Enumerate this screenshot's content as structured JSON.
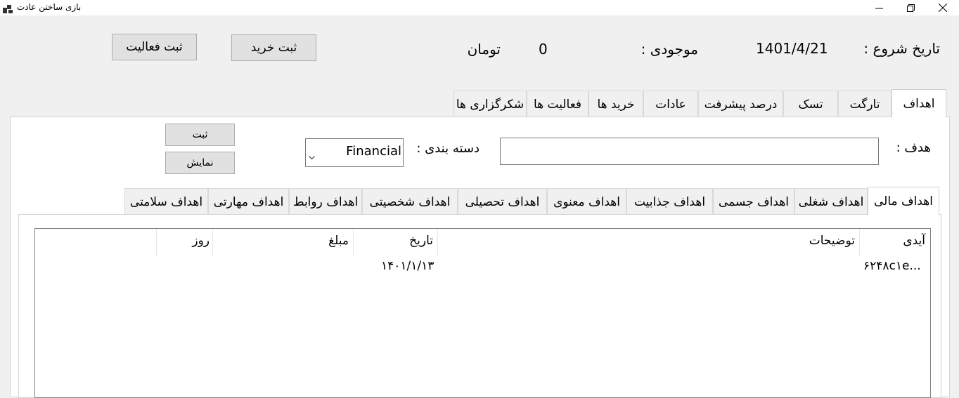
{
  "window": {
    "title": "بازی ساختن عادت",
    "icons": [
      "app-icon",
      "minimize-icon",
      "restore-icon",
      "close-icon"
    ]
  },
  "header": {
    "start_date_label": "تاریخ شروع :",
    "start_date_value": "1401/4/21",
    "balance_label": "موجودی :",
    "balance_value": "0",
    "currency": "تومان",
    "register_purchase_button": "ثبت خرید",
    "register_activity_button": "ثبت فعالیت"
  },
  "main_tabs": [
    {
      "label": "اهداف",
      "active": true
    },
    {
      "label": "تارگت"
    },
    {
      "label": "تسک"
    },
    {
      "label": "درصد پیشرفت"
    },
    {
      "label": "عادات"
    },
    {
      "label": "خرید ها"
    },
    {
      "label": "فعالیت ها"
    },
    {
      "label": "شکرگزاری ها"
    }
  ],
  "goal_form": {
    "goal_label": "هدف :",
    "goal_value": "",
    "category_label": "دسته بندی :",
    "category_value": "Financial",
    "submit_button": "ثبت",
    "show_button": "نمایش"
  },
  "goal_tabs": [
    {
      "label": "اهداف مالی",
      "active": true
    },
    {
      "label": "اهداف شغلی"
    },
    {
      "label": "اهداف جسمی"
    },
    {
      "label": "اهداف جذابیت"
    },
    {
      "label": "اهداف معنوی"
    },
    {
      "label": "اهداف تحصیلی"
    },
    {
      "label": "اهداف شخصیتی"
    },
    {
      "label": "اهداف روابط"
    },
    {
      "label": "اهداف مهارتی"
    },
    {
      "label": "اهداف سلامتی"
    }
  ],
  "table": {
    "columns": [
      "آیدی",
      "توضیحات",
      "تاریخ",
      "مبلغ",
      "روز"
    ],
    "rows": [
      {
        "id": "۶۲۴۸c۱e...",
        "description": "",
        "date": "۱۴۰۱/۱/۱۳",
        "amount": "",
        "day": ""
      }
    ]
  },
  "colors": {
    "window_bg": "#f0f0f0",
    "panel_bg": "#ffffff",
    "button_bg": "#e1e1e1"
  }
}
